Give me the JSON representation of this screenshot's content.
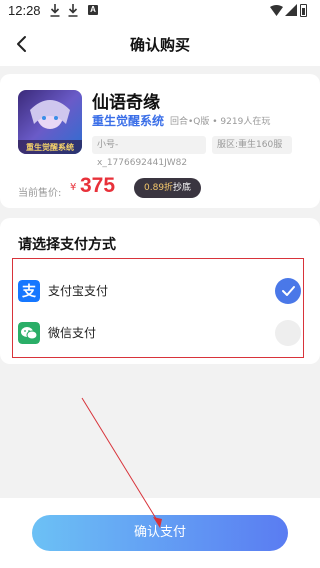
{
  "status": {
    "time": "12:28",
    "a_icon_text": "A"
  },
  "nav": {
    "title": "确认购买",
    "back_icon": "chevron-left-icon"
  },
  "game": {
    "name": "仙语奇缘",
    "cover_text": "重生觉醒系统",
    "subtitle": "重生觉醒系统",
    "meta": "回合•Q版 • 9219人在玩",
    "tags": [
      "小号-x_1776692441JW82",
      "服区:重生160服"
    ]
  },
  "price": {
    "label": "当前售价:",
    "currency": "¥",
    "value": "375",
    "discount_num": "0.89折",
    "discount_suffix": "抄底"
  },
  "payment": {
    "title": "请选择支付方式",
    "methods": [
      {
        "label": "支付宝支付",
        "icon": "alipay-icon",
        "selected": true,
        "color": "#1677ff"
      },
      {
        "label": "微信支付",
        "icon": "wechat-icon",
        "selected": false,
        "color": "#2aae67"
      }
    ]
  },
  "confirm_button": {
    "label": "确认支付"
  },
  "colors": {
    "accent": "#4a78e8",
    "price_red": "#e8313a",
    "annotation_red": "#d8333a"
  }
}
